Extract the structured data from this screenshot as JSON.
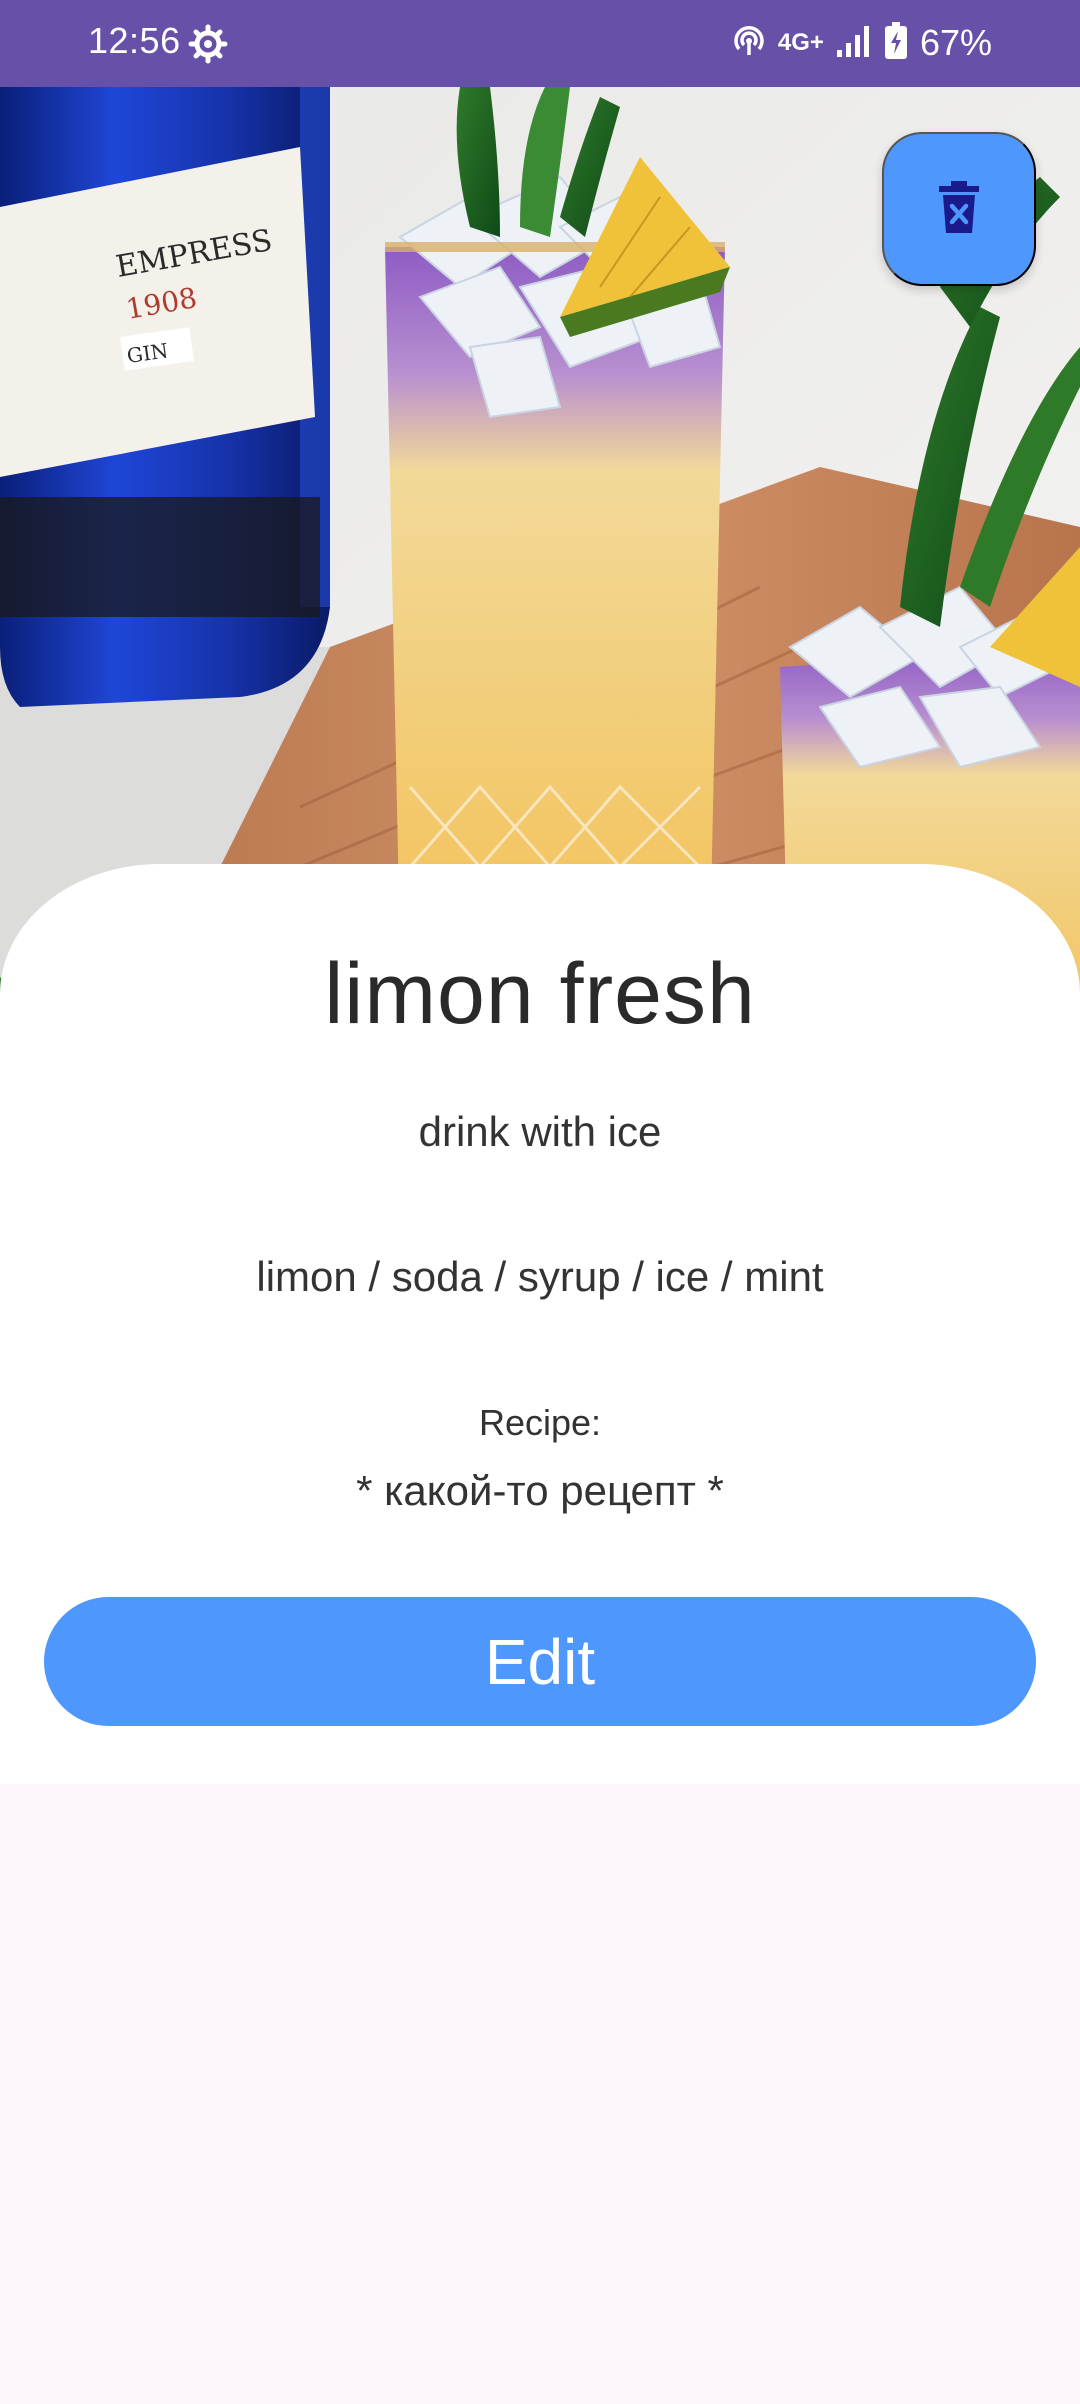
{
  "status_bar": {
    "time": "12:56",
    "network": "4G+",
    "battery": "67%"
  },
  "hero": {
    "bottle_brand": "EMPRESS",
    "bottle_year": "1908",
    "bottle_type": "GIN"
  },
  "drink": {
    "name": "limon fresh",
    "description": "drink with ice",
    "ingredients": "limon / soda / syrup / ice / mint",
    "recipe_label": "Recipe:",
    "recipe": "* какой-то рецепт *"
  },
  "actions": {
    "edit_label": "Edit",
    "delete_icon": "delete-icon"
  },
  "colors": {
    "status_bar": "#6750a8",
    "accent": "#4d97fd",
    "background": "#fdf7fb",
    "card": "#ffffff",
    "icon_dark": "#1a1a8c"
  }
}
